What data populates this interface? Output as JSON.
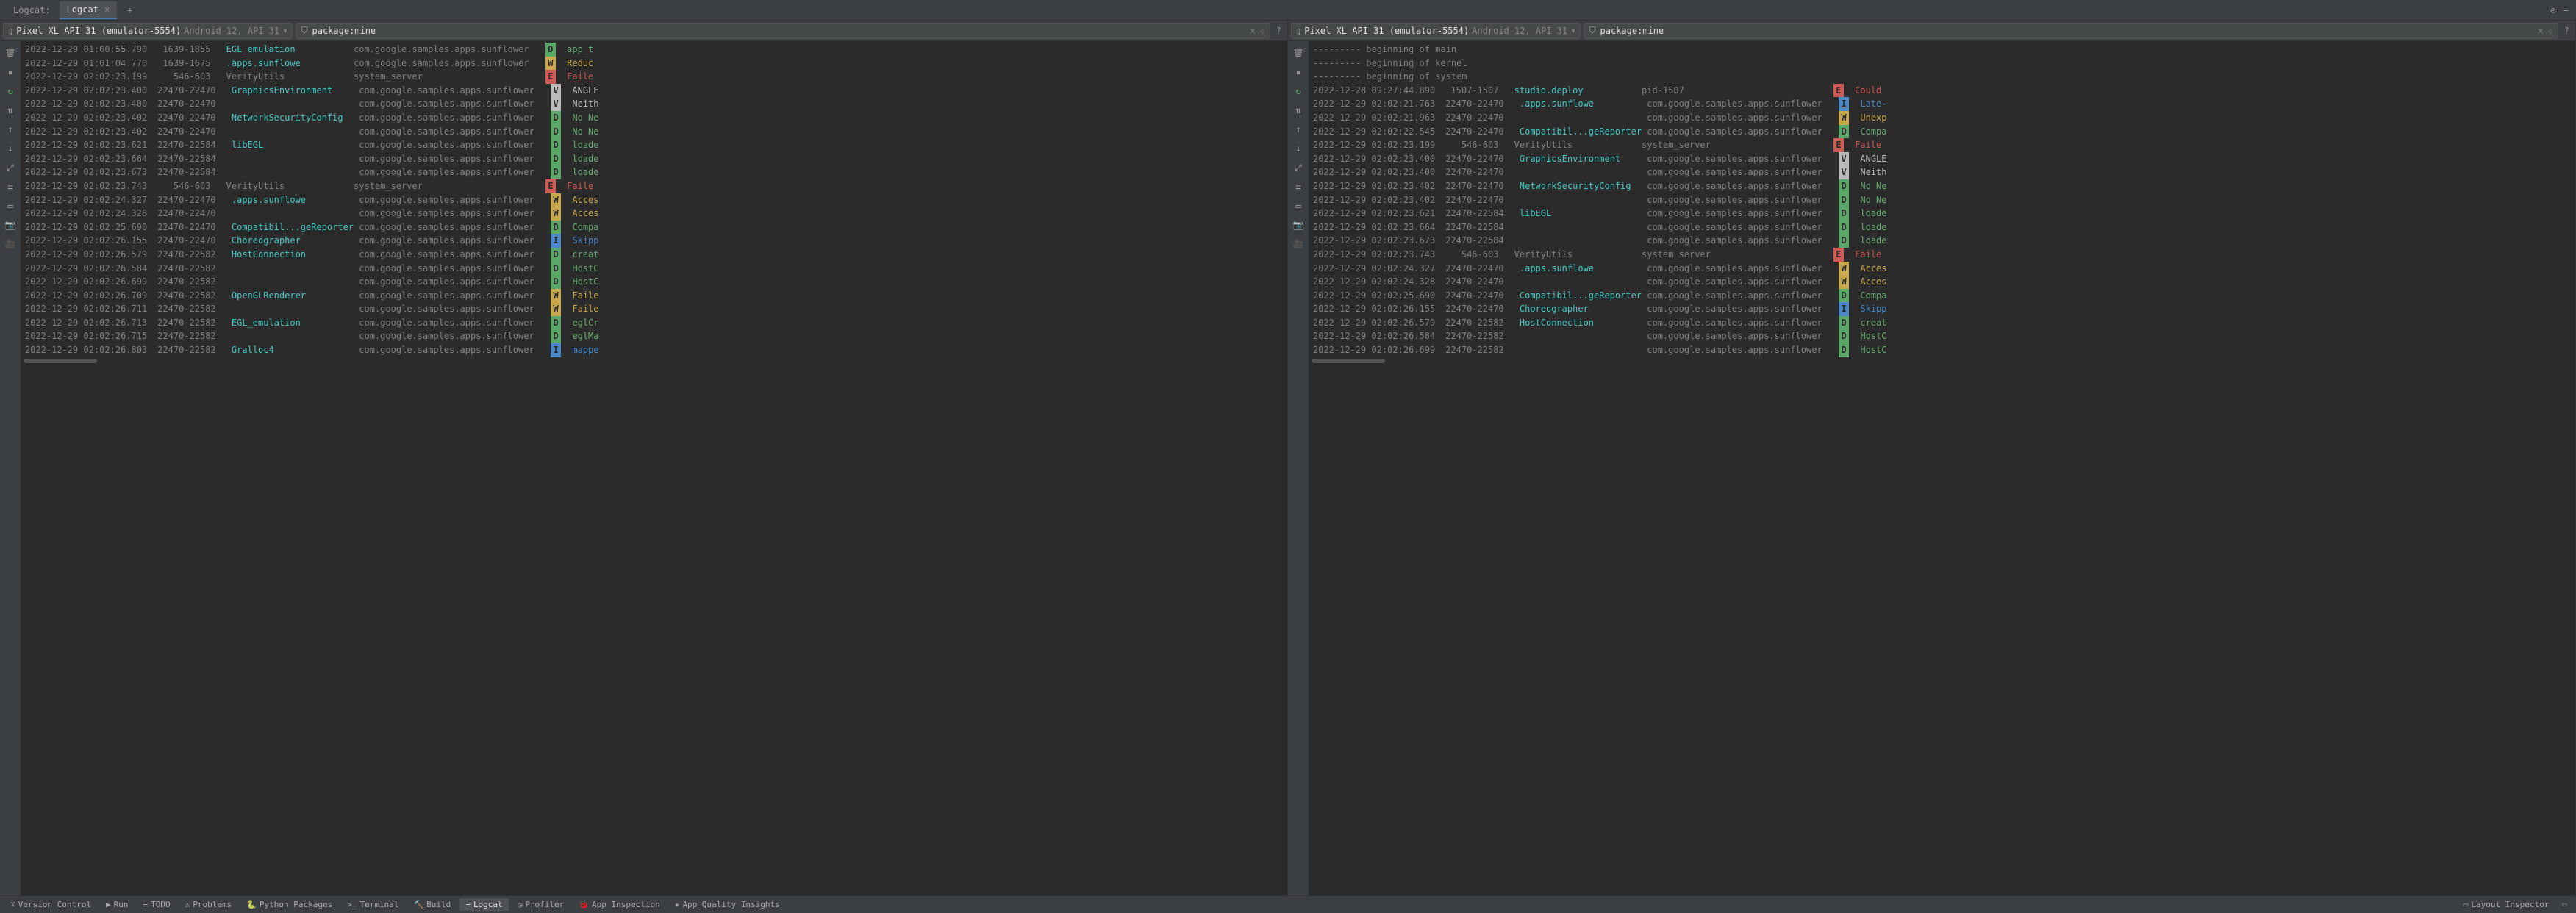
{
  "tabs": {
    "label": "Logcat:",
    "active": "Logcat"
  },
  "device": {
    "icon": "📱",
    "main": "Pixel XL API 31 (emulator-5554)",
    "sub": "Android 12, API 31"
  },
  "filter": {
    "value": "package:mine",
    "icon": "⚙"
  },
  "separators": [
    "--------- beginning of main",
    "--------- beginning of kernel",
    "--------- beginning of system"
  ],
  "left_logs": [
    {
      "time": "2022-12-29 01:00:55.790",
      "pid": " 1639-1855",
      "tag": "EGL_emulation",
      "tag_color": "cyan",
      "pkg": "com.google.samples.apps.sunflower",
      "lvl": "D",
      "msg": "app_t"
    },
    {
      "time": "2022-12-29 01:01:04.770",
      "pid": " 1639-1675",
      "tag": ".apps.sunflowe",
      "tag_color": "cyan",
      "pkg": "com.google.samples.apps.sunflower",
      "lvl": "W",
      "msg": "Reduc"
    },
    {
      "time": "2022-12-29 02:02:23.199",
      "pid": "   546-603",
      "tag": "VerityUtils",
      "tag_color": "plain",
      "pkg": "system_server",
      "lvl": "E",
      "msg": "Faile"
    },
    {
      "time": "2022-12-29 02:02:23.400",
      "pid": "22470-22470",
      "tag": "GraphicsEnvironment",
      "tag_color": "cyan",
      "pkg": "com.google.samples.apps.sunflower",
      "lvl": "V",
      "msg": "ANGLE"
    },
    {
      "time": "2022-12-29 02:02:23.400",
      "pid": "22470-22470",
      "tag": "",
      "tag_color": "plain",
      "pkg": "com.google.samples.apps.sunflower",
      "lvl": "V",
      "msg": "Neith"
    },
    {
      "time": "2022-12-29 02:02:23.402",
      "pid": "22470-22470",
      "tag": "NetworkSecurityConfig",
      "tag_color": "cyan",
      "pkg": "com.google.samples.apps.sunflower",
      "lvl": "D",
      "msg": "No Ne"
    },
    {
      "time": "2022-12-29 02:02:23.402",
      "pid": "22470-22470",
      "tag": "",
      "tag_color": "plain",
      "pkg": "com.google.samples.apps.sunflower",
      "lvl": "D",
      "msg": "No Ne"
    },
    {
      "time": "2022-12-29 02:02:23.621",
      "pid": "22470-22584",
      "tag": "libEGL",
      "tag_color": "cyan",
      "pkg": "com.google.samples.apps.sunflower",
      "lvl": "D",
      "msg": "loade"
    },
    {
      "time": "2022-12-29 02:02:23.664",
      "pid": "22470-22584",
      "tag": "",
      "tag_color": "plain",
      "pkg": "com.google.samples.apps.sunflower",
      "lvl": "D",
      "msg": "loade"
    },
    {
      "time": "2022-12-29 02:02:23.673",
      "pid": "22470-22584",
      "tag": "",
      "tag_color": "plain",
      "pkg": "com.google.samples.apps.sunflower",
      "lvl": "D",
      "msg": "loade"
    },
    {
      "time": "2022-12-29 02:02:23.743",
      "pid": "   546-603",
      "tag": "VerityUtils",
      "tag_color": "plain",
      "pkg": "system_server",
      "lvl": "E",
      "msg": "Faile"
    },
    {
      "time": "2022-12-29 02:02:24.327",
      "pid": "22470-22470",
      "tag": ".apps.sunflowe",
      "tag_color": "cyan",
      "pkg": "com.google.samples.apps.sunflower",
      "lvl": "W",
      "msg": "Acces"
    },
    {
      "time": "2022-12-29 02:02:24.328",
      "pid": "22470-22470",
      "tag": "",
      "tag_color": "plain",
      "pkg": "com.google.samples.apps.sunflower",
      "lvl": "W",
      "msg": "Acces"
    },
    {
      "time": "2022-12-29 02:02:25.690",
      "pid": "22470-22470",
      "tag": "Compatibil...geReporter",
      "tag_color": "cyan",
      "pkg": "com.google.samples.apps.sunflower",
      "lvl": "D",
      "msg": "Compa"
    },
    {
      "time": "2022-12-29 02:02:26.155",
      "pid": "22470-22470",
      "tag": "Choreographer",
      "tag_color": "cyan",
      "pkg": "com.google.samples.apps.sunflower",
      "lvl": "I",
      "msg": "Skipp"
    },
    {
      "time": "2022-12-29 02:02:26.579",
      "pid": "22470-22582",
      "tag": "HostConnection",
      "tag_color": "cyan",
      "pkg": "com.google.samples.apps.sunflower",
      "lvl": "D",
      "msg": "creat"
    },
    {
      "time": "2022-12-29 02:02:26.584",
      "pid": "22470-22582",
      "tag": "",
      "tag_color": "plain",
      "pkg": "com.google.samples.apps.sunflower",
      "lvl": "D",
      "msg": "HostC"
    },
    {
      "time": "2022-12-29 02:02:26.699",
      "pid": "22470-22582",
      "tag": "",
      "tag_color": "plain",
      "pkg": "com.google.samples.apps.sunflower",
      "lvl": "D",
      "msg": "HostC"
    },
    {
      "time": "2022-12-29 02:02:26.709",
      "pid": "22470-22582",
      "tag": "OpenGLRenderer",
      "tag_color": "cyan",
      "pkg": "com.google.samples.apps.sunflower",
      "lvl": "W",
      "msg": "Faile"
    },
    {
      "time": "2022-12-29 02:02:26.711",
      "pid": "22470-22582",
      "tag": "",
      "tag_color": "plain",
      "pkg": "com.google.samples.apps.sunflower",
      "lvl": "W",
      "msg": "Faile"
    },
    {
      "time": "2022-12-29 02:02:26.713",
      "pid": "22470-22582",
      "tag": "EGL_emulation",
      "tag_color": "cyan",
      "pkg": "com.google.samples.apps.sunflower",
      "lvl": "D",
      "msg": "eglCr"
    },
    {
      "time": "2022-12-29 02:02:26.715",
      "pid": "22470-22582",
      "tag": "",
      "tag_color": "plain",
      "pkg": "com.google.samples.apps.sunflower",
      "lvl": "D",
      "msg": "eglMa"
    },
    {
      "time": "2022-12-29 02:02:26.803",
      "pid": "22470-22582",
      "tag": "Gralloc4",
      "tag_color": "cyan",
      "pkg": "com.google.samples.apps.sunflower",
      "lvl": "I",
      "msg": "mappe"
    }
  ],
  "right_logs": [
    {
      "time": "2022-12-28 09:27:44.890",
      "pid": " 1507-1507",
      "tag": "studio.deploy",
      "tag_color": "cyan",
      "pkg": "pid-1507",
      "lvl": "E",
      "msg": "Could"
    },
    {
      "time": "2022-12-29 02:02:21.763",
      "pid": "22470-22470",
      "tag": ".apps.sunflowe",
      "tag_color": "cyan",
      "pkg": "com.google.samples.apps.sunflower",
      "lvl": "I",
      "msg": "Late-"
    },
    {
      "time": "2022-12-29 02:02:21.963",
      "pid": "22470-22470",
      "tag": "",
      "tag_color": "plain",
      "pkg": "com.google.samples.apps.sunflower",
      "lvl": "W",
      "msg": "Unexp"
    },
    {
      "time": "2022-12-29 02:02:22.545",
      "pid": "22470-22470",
      "tag": "Compatibil...geReporter",
      "tag_color": "cyan",
      "pkg": "com.google.samples.apps.sunflower",
      "lvl": "D",
      "msg": "Compa"
    },
    {
      "time": "2022-12-29 02:02:23.199",
      "pid": "   546-603",
      "tag": "VerityUtils",
      "tag_color": "plain",
      "pkg": "system_server",
      "lvl": "E",
      "msg": "Faile"
    },
    {
      "time": "2022-12-29 02:02:23.400",
      "pid": "22470-22470",
      "tag": "GraphicsEnvironment",
      "tag_color": "cyan",
      "pkg": "com.google.samples.apps.sunflower",
      "lvl": "V",
      "msg": "ANGLE"
    },
    {
      "time": "2022-12-29 02:02:23.400",
      "pid": "22470-22470",
      "tag": "",
      "tag_color": "plain",
      "pkg": "com.google.samples.apps.sunflower",
      "lvl": "V",
      "msg": "Neith"
    },
    {
      "time": "2022-12-29 02:02:23.402",
      "pid": "22470-22470",
      "tag": "NetworkSecurityConfig",
      "tag_color": "cyan",
      "pkg": "com.google.samples.apps.sunflower",
      "lvl": "D",
      "msg": "No Ne"
    },
    {
      "time": "2022-12-29 02:02:23.402",
      "pid": "22470-22470",
      "tag": "",
      "tag_color": "plain",
      "pkg": "com.google.samples.apps.sunflower",
      "lvl": "D",
      "msg": "No Ne"
    },
    {
      "time": "2022-12-29 02:02:23.621",
      "pid": "22470-22584",
      "tag": "libEGL",
      "tag_color": "cyan",
      "pkg": "com.google.samples.apps.sunflower",
      "lvl": "D",
      "msg": "loade"
    },
    {
      "time": "2022-12-29 02:02:23.664",
      "pid": "22470-22584",
      "tag": "",
      "tag_color": "plain",
      "pkg": "com.google.samples.apps.sunflower",
      "lvl": "D",
      "msg": "loade"
    },
    {
      "time": "2022-12-29 02:02:23.673",
      "pid": "22470-22584",
      "tag": "",
      "tag_color": "plain",
      "pkg": "com.google.samples.apps.sunflower",
      "lvl": "D",
      "msg": "loade"
    },
    {
      "time": "2022-12-29 02:02:23.743",
      "pid": "   546-603",
      "tag": "VerityUtils",
      "tag_color": "plain",
      "pkg": "system_server",
      "lvl": "E",
      "msg": "Faile"
    },
    {
      "time": "2022-12-29 02:02:24.327",
      "pid": "22470-22470",
      "tag": ".apps.sunflowe",
      "tag_color": "cyan",
      "pkg": "com.google.samples.apps.sunflower",
      "lvl": "W",
      "msg": "Acces"
    },
    {
      "time": "2022-12-29 02:02:24.328",
      "pid": "22470-22470",
      "tag": "",
      "tag_color": "plain",
      "pkg": "com.google.samples.apps.sunflower",
      "lvl": "W",
      "msg": "Acces"
    },
    {
      "time": "2022-12-29 02:02:25.690",
      "pid": "22470-22470",
      "tag": "Compatibil...geReporter",
      "tag_color": "cyan",
      "pkg": "com.google.samples.apps.sunflower",
      "lvl": "D",
      "msg": "Compa"
    },
    {
      "time": "2022-12-29 02:02:26.155",
      "pid": "22470-22470",
      "tag": "Choreographer",
      "tag_color": "cyan",
      "pkg": "com.google.samples.apps.sunflower",
      "lvl": "I",
      "msg": "Skipp"
    },
    {
      "time": "2022-12-29 02:02:26.579",
      "pid": "22470-22582",
      "tag": "HostConnection",
      "tag_color": "cyan",
      "pkg": "com.google.samples.apps.sunflower",
      "lvl": "D",
      "msg": "creat"
    },
    {
      "time": "2022-12-29 02:02:26.584",
      "pid": "22470-22582",
      "tag": "",
      "tag_color": "plain",
      "pkg": "com.google.samples.apps.sunflower",
      "lvl": "D",
      "msg": "HostC"
    },
    {
      "time": "2022-12-29 02:02:26.699",
      "pid": "22470-22582",
      "tag": "",
      "tag_color": "plain",
      "pkg": "com.google.samples.apps.sunflower",
      "lvl": "D",
      "msg": "HostC"
    }
  ],
  "bottom": {
    "items": [
      {
        "icon": "⌥",
        "label": "Version Control"
      },
      {
        "icon": "▶",
        "label": "Run"
      },
      {
        "icon": "≡",
        "label": "TODO"
      },
      {
        "icon": "⚠",
        "label": "Problems"
      },
      {
        "icon": "🐍",
        "label": "Python Packages"
      },
      {
        "icon": ">_",
        "label": "Terminal"
      },
      {
        "icon": "🔨",
        "label": "Build"
      },
      {
        "icon": "≡",
        "label": "Logcat",
        "active": true
      },
      {
        "icon": "◷",
        "label": "Profiler"
      },
      {
        "icon": "🐞",
        "label": "App Inspection"
      },
      {
        "icon": "✦",
        "label": "App Quality Insights"
      }
    ],
    "right": {
      "icon": "▭",
      "label": "Layout Inspector"
    }
  },
  "side_icons": [
    "🗑",
    "⏸",
    "↻",
    "⇅",
    "↑",
    "↓",
    "⤢",
    "≡",
    "▭",
    "📷",
    "🎥"
  ]
}
